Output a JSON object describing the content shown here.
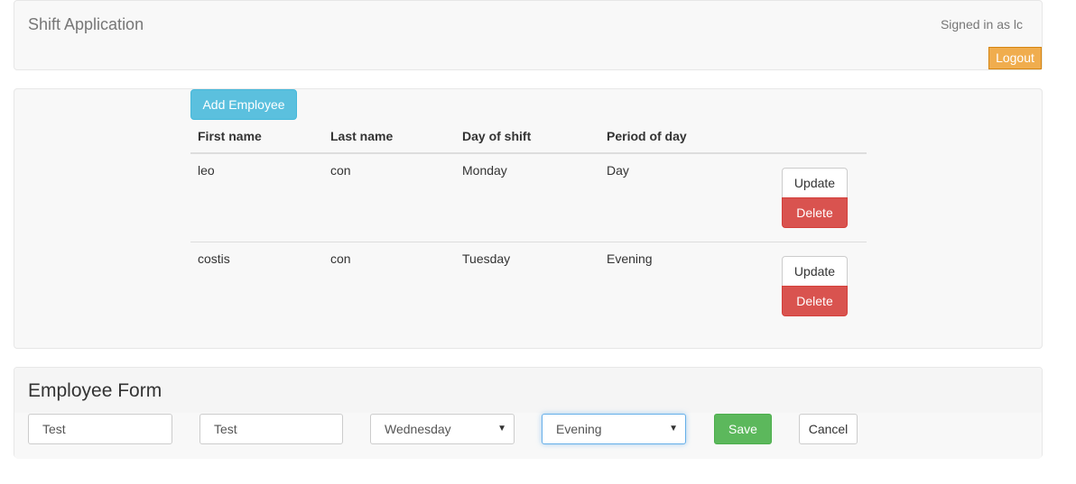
{
  "navbar": {
    "brand": "Shift Application",
    "signed_in": "Signed in as lc",
    "logout_label": "Logout"
  },
  "list": {
    "add_label": "Add Employee",
    "columns": [
      "First name",
      "Last name",
      "Day of shift",
      "Period of day"
    ],
    "rows": [
      {
        "first": "leo",
        "last": "con",
        "day": "Monday",
        "period": "Day",
        "update_label": "Update",
        "delete_label": "Delete"
      },
      {
        "first": "costis",
        "last": "con",
        "day": "Tuesday",
        "period": "Evening",
        "update_label": "Update",
        "delete_label": "Delete"
      }
    ]
  },
  "form": {
    "title": "Employee Form",
    "first_name_value": "Test",
    "last_name_value": "Test",
    "day_selected": "Wednesday",
    "period_selected": "Evening",
    "caret_glyph": "▼",
    "save_label": "Save",
    "cancel_label": "Cancel"
  },
  "colors": {
    "logout": "#f0ad4e",
    "add": "#5bc0de",
    "delete": "#d9534f",
    "save": "#5cb85c"
  }
}
